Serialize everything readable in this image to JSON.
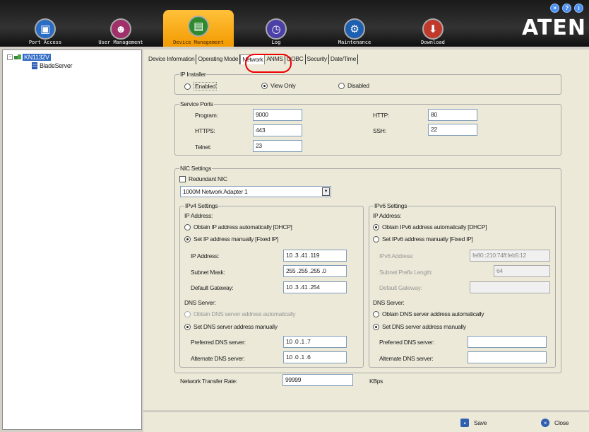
{
  "topbar": {
    "nav": [
      {
        "label": "Port Access",
        "icon": "monitor-icon",
        "active": false
      },
      {
        "label": "User Management",
        "icon": "users-icon",
        "active": false
      },
      {
        "label": "Device Management",
        "icon": "device-icon",
        "active": true
      },
      {
        "label": "Log",
        "icon": "log-icon",
        "active": false
      },
      {
        "label": "Maintenance",
        "icon": "maintenance-icon",
        "active": false
      },
      {
        "label": "Download",
        "icon": "download-icon",
        "active": false
      }
    ],
    "window_buttons": [
      "×",
      "?",
      "i"
    ],
    "logo": "ATEN"
  },
  "sidebar": {
    "root": {
      "label": "KN1132V",
      "toggle": "-"
    },
    "child": {
      "label": "BladeServer"
    }
  },
  "tabs": [
    "Device Information",
    "Operating Mode",
    "Network",
    "ANMS",
    "OOBC",
    "Security",
    "Date/Time"
  ],
  "selected_tab": "Network",
  "ip_installer": {
    "legend": "IP Installer",
    "options": [
      "Enabled",
      "View Only",
      "Disabled"
    ],
    "selected": "View Only"
  },
  "service_ports": {
    "legend": "Service Ports",
    "program": {
      "label": "Program:",
      "value": "9000"
    },
    "https": {
      "label": "HTTPS:",
      "value": "443"
    },
    "telnet": {
      "label": "Telnet:",
      "value": "23"
    },
    "http": {
      "label": "HTTP:",
      "value": "80"
    },
    "ssh": {
      "label": "SSH:",
      "value": "22"
    }
  },
  "nic": {
    "legend": "NIC Settings",
    "redundant_label": "Redundant NIC",
    "redundant_checked": false,
    "adapter": "1000M Network Adapter 1",
    "ipv4": {
      "legend": "IPv4 Settings",
      "ip_address_heading": "IP Address:",
      "opt_auto": "Obtain IP address automatically [DHCP]",
      "opt_manual": "Set IP address manually [Fixed IP]",
      "selected": "manual",
      "ip": {
        "label": "IP Address:",
        "value": "10  .3   .41  .119"
      },
      "mask": {
        "label": "Subnet Mask:",
        "value": "255 .255 .255 .0"
      },
      "gateway": {
        "label": "Default Gateway:",
        "value": "10  .3   .41  .254"
      },
      "dns_heading": "DNS Server:",
      "dns_auto": "Obtain DNS server address automatically",
      "dns_manual": "Set DNS server address manually",
      "dns_selected": "manual",
      "preferred": {
        "label": "Preferred DNS server:",
        "value": "10  .0   .1   .7"
      },
      "alternate": {
        "label": "Alternate DNS server:",
        "value": "10  .0   .1   .6"
      }
    },
    "ipv6": {
      "legend": "IPv6 Settings",
      "ip_address_heading": "IP Address:",
      "opt_auto": "Obtain IPv6 address automatically [DHCP]",
      "opt_manual": "Set IPv6 address manually [Fixed IP]",
      "selected": "auto",
      "ip": {
        "label": "IPv6 Address:",
        "value": "fe80::210:74ff:feb5:12"
      },
      "prefix": {
        "label": "Subnet Prefix Length:",
        "value": "64"
      },
      "gateway": {
        "label": "Default Gateway:",
        "value": ""
      },
      "dns_heading": "DNS Server:",
      "dns_auto": "Obtain DNS server address automatically",
      "dns_manual": "Set DNS server address manually",
      "dns_selected": "manual",
      "preferred": {
        "label": "Preferred DNS server:",
        "value": ""
      },
      "alternate": {
        "label": "Alternate DNS server:",
        "value": ""
      }
    }
  },
  "transfer_rate": {
    "label": "Network Transfer Rate:",
    "value": "99999",
    "unit": "KBps"
  },
  "actions": {
    "save": "Save",
    "close": "Close"
  },
  "colors": {
    "accent_orange": "#f39a00",
    "highlight_red": "#e00000",
    "selection_blue": "#316ac5"
  }
}
